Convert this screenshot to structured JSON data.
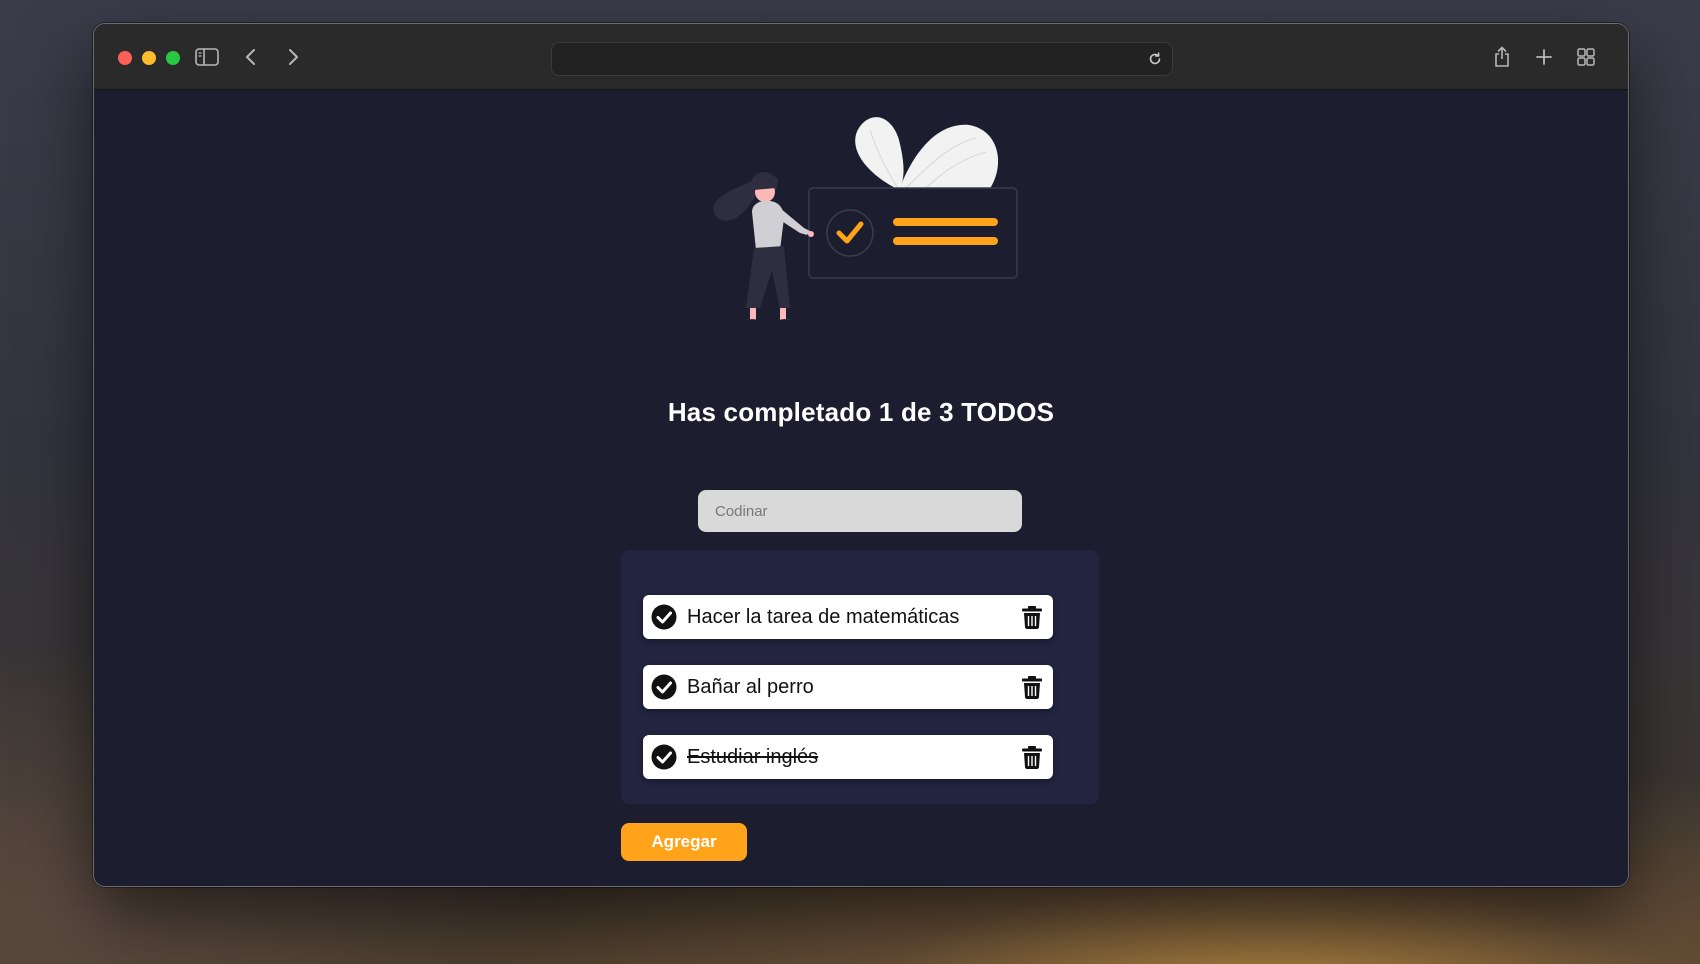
{
  "browser": {
    "url": ""
  },
  "page": {
    "title": "Has completado 1 de 3 TODOS"
  },
  "search": {
    "placeholder": "Codinar",
    "value": ""
  },
  "todos": [
    {
      "text": "Hacer la tarea de matemáticas",
      "completed": false
    },
    {
      "text": "Bañar al perro",
      "completed": false
    },
    {
      "text": "Estudiar inglés",
      "completed": true
    }
  ],
  "add_button": {
    "label": "Agregar"
  },
  "colors": {
    "accent": "#ffa41a",
    "page_background": "#1c1d2e",
    "card_background": "#222440"
  },
  "icons": {
    "todo_check": "check-circle-icon",
    "todo_delete": "trash-icon"
  }
}
